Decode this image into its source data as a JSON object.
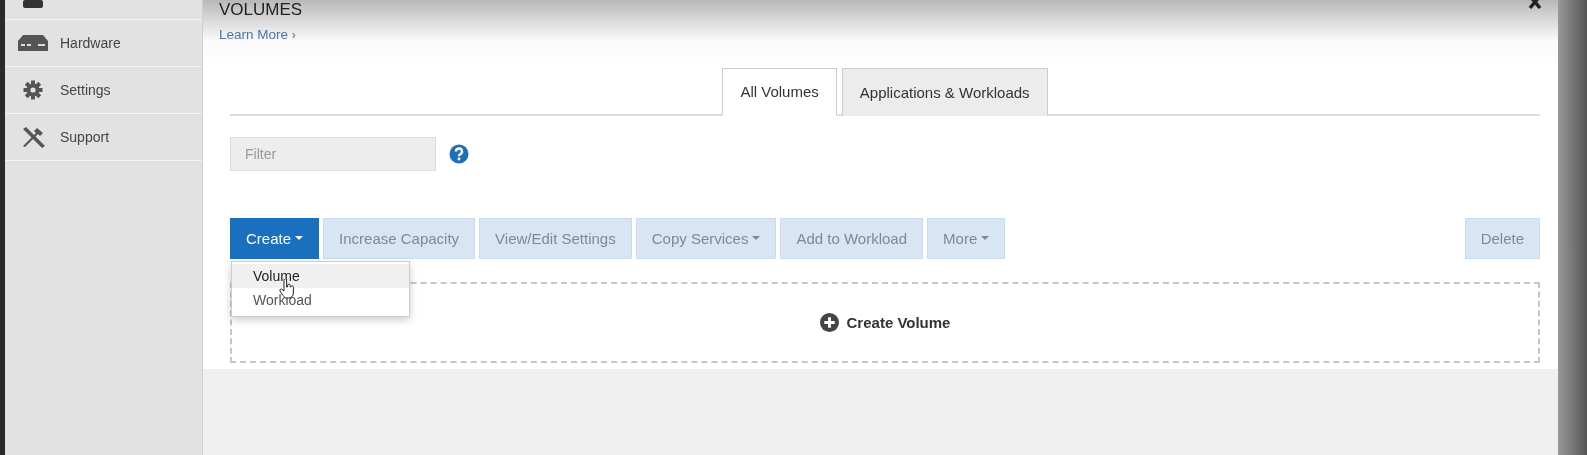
{
  "sidebar": {
    "items": [
      {
        "label": "Hardware"
      },
      {
        "label": "Settings"
      },
      {
        "label": "Support"
      }
    ]
  },
  "page": {
    "title": "VOLUMES",
    "learn_more": "Learn More",
    "learn_more_arrow": "›"
  },
  "tabs": [
    {
      "label": "All Volumes",
      "selected": true
    },
    {
      "label": "Applications & Workloads",
      "selected": false
    }
  ],
  "filter": {
    "placeholder": "Filter"
  },
  "toolbar": [
    {
      "label": "Create",
      "dropdown": true,
      "disabled": false
    },
    {
      "label": "Increase Capacity",
      "dropdown": false,
      "disabled": true
    },
    {
      "label": "View/Edit Settings",
      "dropdown": false,
      "disabled": true
    },
    {
      "label": "Copy Services",
      "dropdown": true,
      "disabled": true
    },
    {
      "label": "Add to Workload",
      "dropdown": false,
      "disabled": true
    },
    {
      "label": "More",
      "dropdown": true,
      "disabled": true
    }
  ],
  "delete_button": {
    "label": "Delete",
    "disabled": true
  },
  "create_menu": {
    "expanded": true,
    "items": [
      {
        "label": "Volume",
        "selected": true
      },
      {
        "label": "Workload",
        "selected": false
      }
    ]
  },
  "empty_state": {
    "label": "Create Volume"
  }
}
